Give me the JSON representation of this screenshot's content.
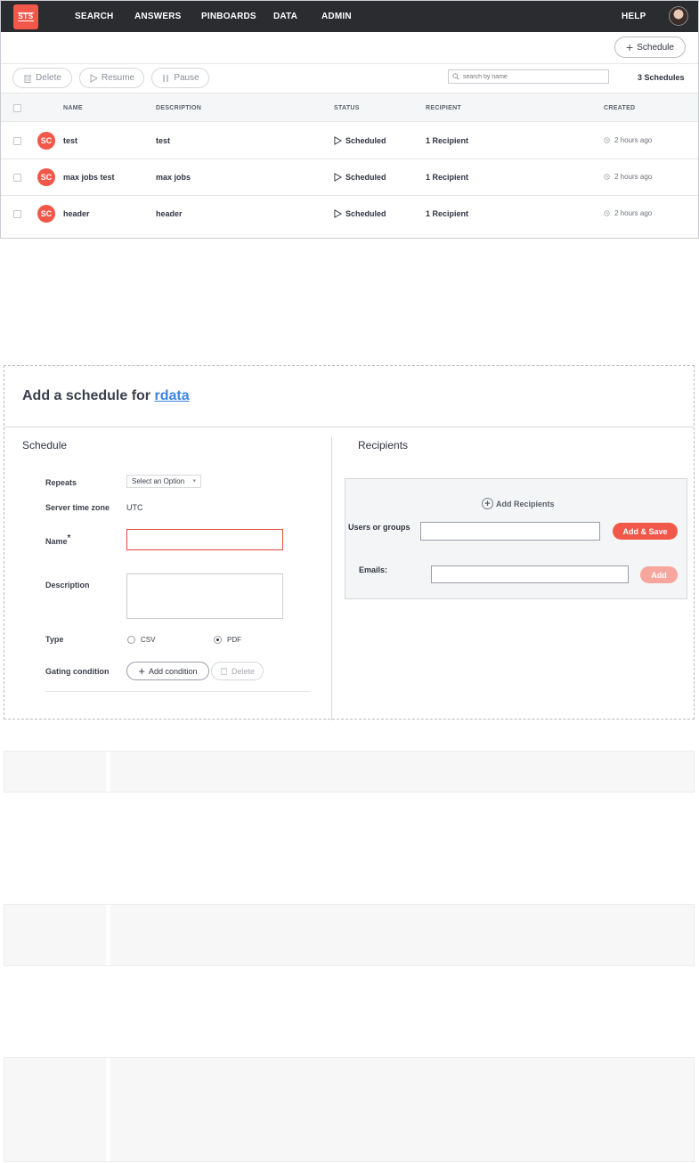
{
  "nav": {
    "logo_text": "STS",
    "items": [
      "SEARCH",
      "ANSWERS",
      "PINBOARDS",
      "DATA",
      "ADMIN"
    ],
    "help": "HELP"
  },
  "list": {
    "schedule_button": "Schedule",
    "toolbar": {
      "delete": "Delete",
      "resume": "Resume",
      "pause": "Pause"
    },
    "search_placeholder": "search by name",
    "count": "3 Schedules",
    "columns": [
      "NAME",
      "DESCRIPTION",
      "STATUS",
      "RECIPIENT",
      "CREATED"
    ],
    "rows": [
      {
        "badge": "SC",
        "name": "test",
        "description": "test",
        "status": "Scheduled",
        "recipient": "1 Recipient",
        "created": "2 hours ago"
      },
      {
        "badge": "SC",
        "name": "max jobs test",
        "description": "max jobs",
        "status": "Scheduled",
        "recipient": "1 Recipient",
        "created": "2 hours ago"
      },
      {
        "badge": "SC",
        "name": "header",
        "description": "header",
        "status": "Scheduled",
        "recipient": "1 Recipient",
        "created": "2 hours ago"
      }
    ]
  },
  "form": {
    "title_prefix": "Add a schedule for ",
    "title_link": "rdata",
    "schedule_section": "Schedule",
    "recipients_section": "Recipients",
    "repeats_label": "Repeats",
    "repeats_value": "Select an Option",
    "timezone_label": "Server time zone",
    "timezone_value": "UTC",
    "name_label": "Name",
    "required_mark": "*",
    "description_label": "Description",
    "type_label": "Type",
    "type_csv": "CSV",
    "type_pdf": "PDF",
    "gating_label": "Gating condition",
    "add_condition": "Add condition",
    "delete": "Delete",
    "add_recipients": "Add Recipients",
    "users_label": "Users or groups",
    "add_save": "Add & Save",
    "emails_label": "Emails:",
    "add": "Add"
  },
  "colors": {
    "brand": "#f2584a",
    "nav_bg": "#2b2c30",
    "link": "#3b86e0"
  }
}
